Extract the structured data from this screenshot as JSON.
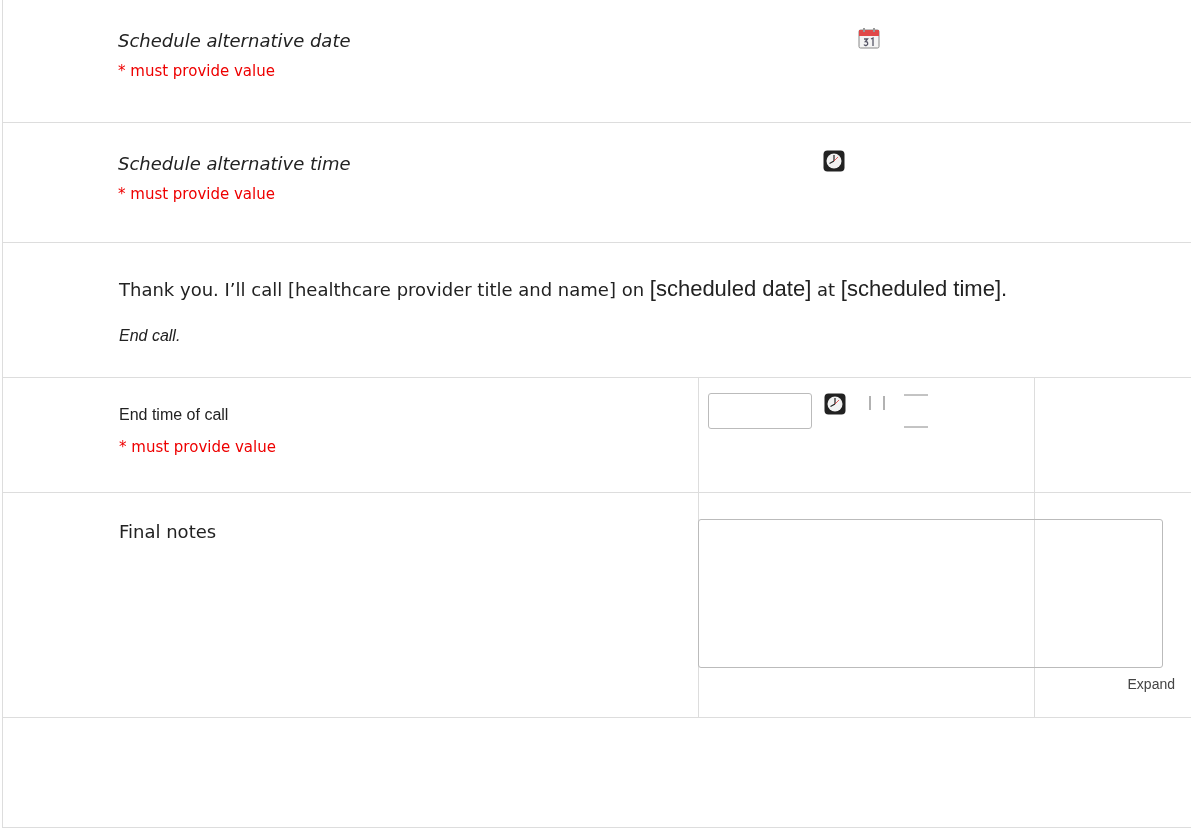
{
  "schedule_date": {
    "label": "Schedule alternative date",
    "required_note": "* must provide value"
  },
  "schedule_time": {
    "label": "Schedule alternative time",
    "required_note": "* must provide value"
  },
  "closing": {
    "statement": [
      {
        "kind": "plain",
        "text": "Thank you. I’ll call [healthcare provider title and name] on "
      },
      {
        "kind": "large",
        "text": "[scheduled date]"
      },
      {
        "kind": "plain",
        "text": " at "
      },
      {
        "kind": "large",
        "text": "[scheduled time]."
      }
    ],
    "instruction": "End call."
  },
  "end_time": {
    "label": "End time of call",
    "required_note": "* must provide value"
  },
  "final_notes": {
    "label": "Final notes",
    "expand_link": "Expand"
  }
}
